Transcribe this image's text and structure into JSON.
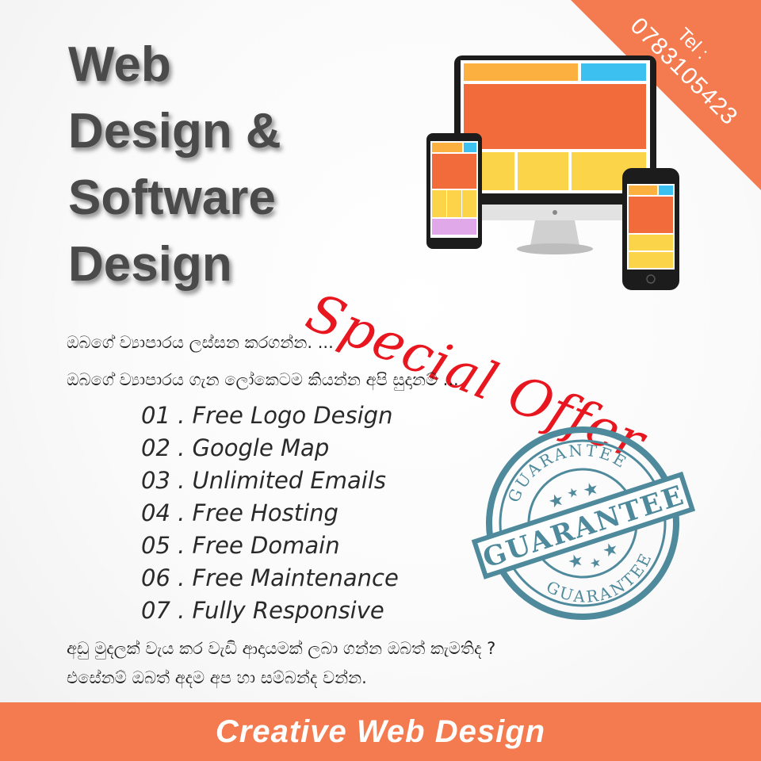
{
  "headline": {
    "lines": [
      "Web",
      "Design &",
      "Software",
      "Design"
    ]
  },
  "contact": {
    "label": "Tel :",
    "number": "0783105423"
  },
  "offer": {
    "text": "Special Offer"
  },
  "intro": {
    "line1": "ඔබගේ  ව්‍යාපාරය ලස්සන කරගන්න. ...",
    "line2": "ඔබගේ  ව්‍යාපාරය ගැන ලෝකෙටම කියන්න අපි සුදානම් ..."
  },
  "features": [
    "01 . Free Logo Design",
    "02 . Google Map",
    "03 . Unlimited Emails",
    "04 . Free Hosting",
    "05 . Free Domain",
    "06 . Free Maintenance",
    "07 . Fully Responsive"
  ],
  "stamp": {
    "text": "GUARANTEE"
  },
  "closing": {
    "line1": "අඩු  මුදලක් වැය කර වැඩි ආදායමක් ලබා ගන්න ඔබත් කැමතිද ?",
    "line2": "එසේනම් ඔබත්  අදම  අප  හා  සම්බන්ද  වන්න."
  },
  "footer": {
    "title": "Creative Web Design"
  },
  "colors": {
    "accent": "#f47a4f",
    "offer_red": "#e8161f",
    "stamp_teal": "#4f8a9c",
    "headline_gray": "#4a4a4a"
  }
}
